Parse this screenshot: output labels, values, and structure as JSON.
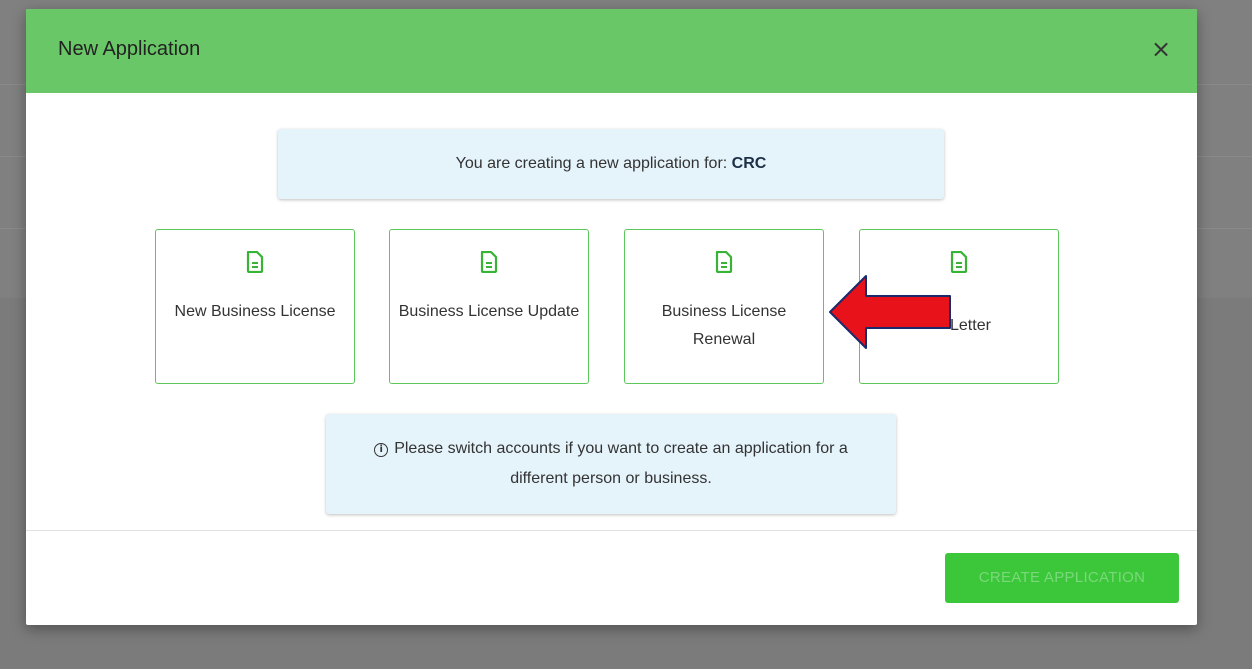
{
  "modal": {
    "title": "New Application",
    "close_label": "×"
  },
  "info_top": {
    "prefix": "You are creating a new application for: ",
    "account": "CRC"
  },
  "cards": [
    {
      "label": "New Business License",
      "icon": "document-icon"
    },
    {
      "label": "Business License Update",
      "icon": "document-icon"
    },
    {
      "label": "Business License Renewal",
      "icon": "document-icon"
    },
    {
      "label": "Letter",
      "icon": "document-icon"
    }
  ],
  "info_bottom": {
    "icon": "i",
    "text": "Please switch accounts if you want to create an application for a different person or business."
  },
  "footer": {
    "create_label": "CREATE APPLICATION"
  },
  "colors": {
    "header": "#6ac767",
    "card_border": "#5cc85a",
    "info_bg": "#e5f3fb",
    "create_button": "#3cc63a",
    "annotation_arrow": "#e8121a"
  }
}
